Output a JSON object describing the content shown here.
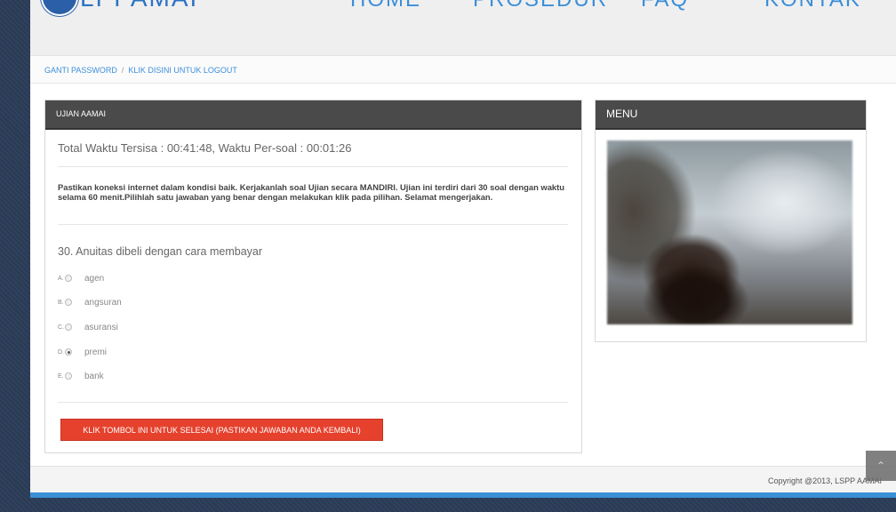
{
  "header": {
    "logo_text": "LPPAMAI",
    "nav": [
      {
        "label": "HOME"
      },
      {
        "label": "PROSEDUR"
      },
      {
        "label": "FAQ"
      },
      {
        "label": "KONTAK"
      }
    ]
  },
  "breadcrumb": {
    "change_password": "GANTI PASSWORD",
    "separator": "/",
    "logout": "KLIK DISINI UNTUK LOGOUT"
  },
  "exam": {
    "title": "UJIAN AAMAI",
    "timer": "Total Waktu Tersisa : 00:41:48, Waktu Per-soal : 00:01:26",
    "instructions": "Pastikan koneksi internet dalam kondisi baik. Kerjakanlah soal Ujian secara MANDIRI. Ujian ini terdiri dari 30 soal dengan waktu selama 60 menit.Pilihlah satu jawaban yang benar dengan melakukan klik pada pilihan. Selamat mengerjakan.",
    "question": "30. Anuitas dibeli dengan cara membayar",
    "options": [
      {
        "letter": "A.",
        "text": "agen",
        "checked": false
      },
      {
        "letter": "B.",
        "text": "angsuran",
        "checked": false
      },
      {
        "letter": "C.",
        "text": "asuransi",
        "checked": false
      },
      {
        "letter": "D.",
        "text": "premi",
        "checked": true
      },
      {
        "letter": "E.",
        "text": "bank",
        "checked": false
      }
    ],
    "finish_button": "KLIK TOMBOL INI UNTUK SELESAI (PASTIKAN JAWABAN ANDA KEMBALI)"
  },
  "menu": {
    "title": "MENU"
  },
  "footer": {
    "copyright": "Copyright @2013, LSPP AAMAI"
  },
  "icons": {
    "scroll_top": "chevron-up-icon"
  },
  "colors": {
    "accent_blue": "#3b8fd9",
    "panel_header": "#4a4a4a",
    "finish_button": "#e5412d"
  }
}
